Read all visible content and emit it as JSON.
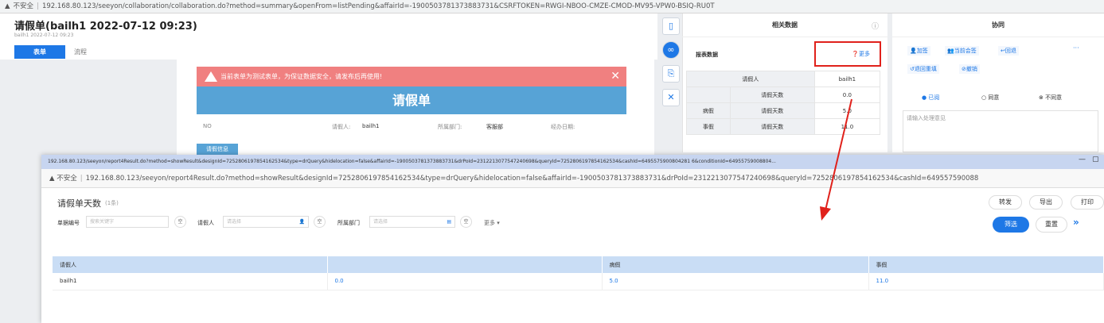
{
  "bg_browser": {
    "security": "不安全",
    "url": "192.168.80.123/seeyon/collaboration/collaboration.do?method=summary&openFrom=listPending&affairId=-1900503781373883731&CSRFTOKEN=RWGI-NBOO-CMZE-CMOD-MV95-VPW0-BSIQ-RU0T"
  },
  "bg_doc": {
    "title": "请假单(bailh1 2022-07-12 09:23)",
    "subtitle": "bailh1   2022-07-12 09:23",
    "tab_form": "表单",
    "tab_flow": "流程",
    "alert_text": "当前表单为测试表单，为保证数据安全，请发布后再使用!",
    "banner": "请假单",
    "fields": {
      "no_label": "NO",
      "applicant_label": "请假人:",
      "applicant_value": "bailh1",
      "dept_label": "所属部门:",
      "dept_value": "客服部",
      "date_label": "经办日期:"
    },
    "section_chip": "请假信息"
  },
  "related": {
    "title": "相关数据",
    "report_label": "报表数据",
    "more": "更多",
    "rows": [
      {
        "a": "",
        "b": "请假人",
        "c": "bailh1"
      },
      {
        "a": "",
        "b": "请假天数",
        "c": "0.0"
      },
      {
        "a": "病假",
        "b": "请假天数",
        "c": "5.0"
      },
      {
        "a": "事假",
        "b": "请假天数",
        "c": "11.0"
      }
    ]
  },
  "coop": {
    "title": "协同",
    "btn_add": "加签",
    "btn_current": "当前会签",
    "btn_back": "回退",
    "btn_return": "退回重填",
    "btn_revoke": "撤销",
    "more": "···",
    "opt_read": "已阅",
    "opt_agree": "同意",
    "opt_disagree": "不同意",
    "opinion_placeholder": "请输入处理意见"
  },
  "popup": {
    "title_url": "192.168.80.123/seeyon/report4Result.do?method=showResult&designId=7252806197854162534&type=drQuery&hidelocation=false&affairId=-1900503781373883731&drPoId=2312213077547240698&queryId=7252806197854162534&cashId=6495575900804281 6&conditionId=64955759008804...",
    "security": "不安全",
    "url": "192.168.80.123/seeyon/report4Result.do?method=showResult&designId=7252806197854162534&type=drQuery&hidelocation=false&affairId=-1900503781373883731&drPoId=2312213077547240698&queryId=7252806197854162534&cashId=649557590088",
    "report_title": "请假单天数",
    "count": "(1条)",
    "filter_no_label": "单据编号",
    "filter_no_placeholder": "搜索关键字",
    "filter_person_label": "请假人",
    "filter_person_placeholder": "请选择",
    "filter_dept_label": "所属部门",
    "filter_dept_placeholder": "请选择",
    "clear": "空",
    "more": "更多",
    "btn_forward": "转发",
    "btn_export": "导出",
    "btn_print": "打印",
    "btn_filter": "筛选",
    "btn_reset": "重置",
    "columns": [
      "请假人",
      "",
      "病假",
      "事假"
    ],
    "rows": [
      [
        "bailh1",
        "0.0",
        "5.0",
        "11.0"
      ]
    ]
  }
}
